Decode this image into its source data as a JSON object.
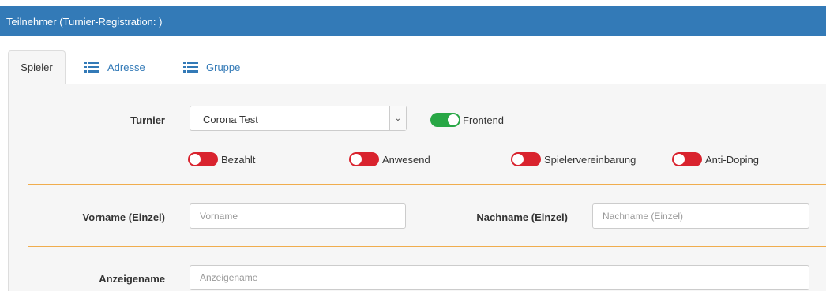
{
  "header": {
    "title": "Teilnehmer (Turnier-Registration: )"
  },
  "tabs": [
    {
      "label": "Spieler",
      "icon": ""
    },
    {
      "label": "Adresse",
      "icon": "list-icon"
    },
    {
      "label": "Gruppe",
      "icon": "list-icon"
    }
  ],
  "form": {
    "turnier_label": "Turnier",
    "turnier_value": "Corona Test",
    "toggles": {
      "frontend": {
        "label": "Frontend",
        "state": "on"
      },
      "bezahlt": {
        "label": "Bezahlt",
        "state": "off"
      },
      "anwesend": {
        "label": "Anwesend",
        "state": "off"
      },
      "spielervereinbarung": {
        "label": "Spielervereinbarung",
        "state": "off"
      },
      "anti_doping": {
        "label": "Anti-Doping",
        "state": "off"
      }
    },
    "vorname_label": "Vorname (Einzel)",
    "vorname_placeholder": "Vorname",
    "nachname_label": "Nachname (Einzel)",
    "nachname_placeholder": "Nachname (Einzel)",
    "anzeigename_label": "Anzeigename",
    "anzeigename_placeholder": "Anzeigename"
  },
  "colors": {
    "header": "#337ab7",
    "toggle_on": "#28a745",
    "toggle_off": "#d9232e",
    "divider": "#f0ad4e"
  }
}
